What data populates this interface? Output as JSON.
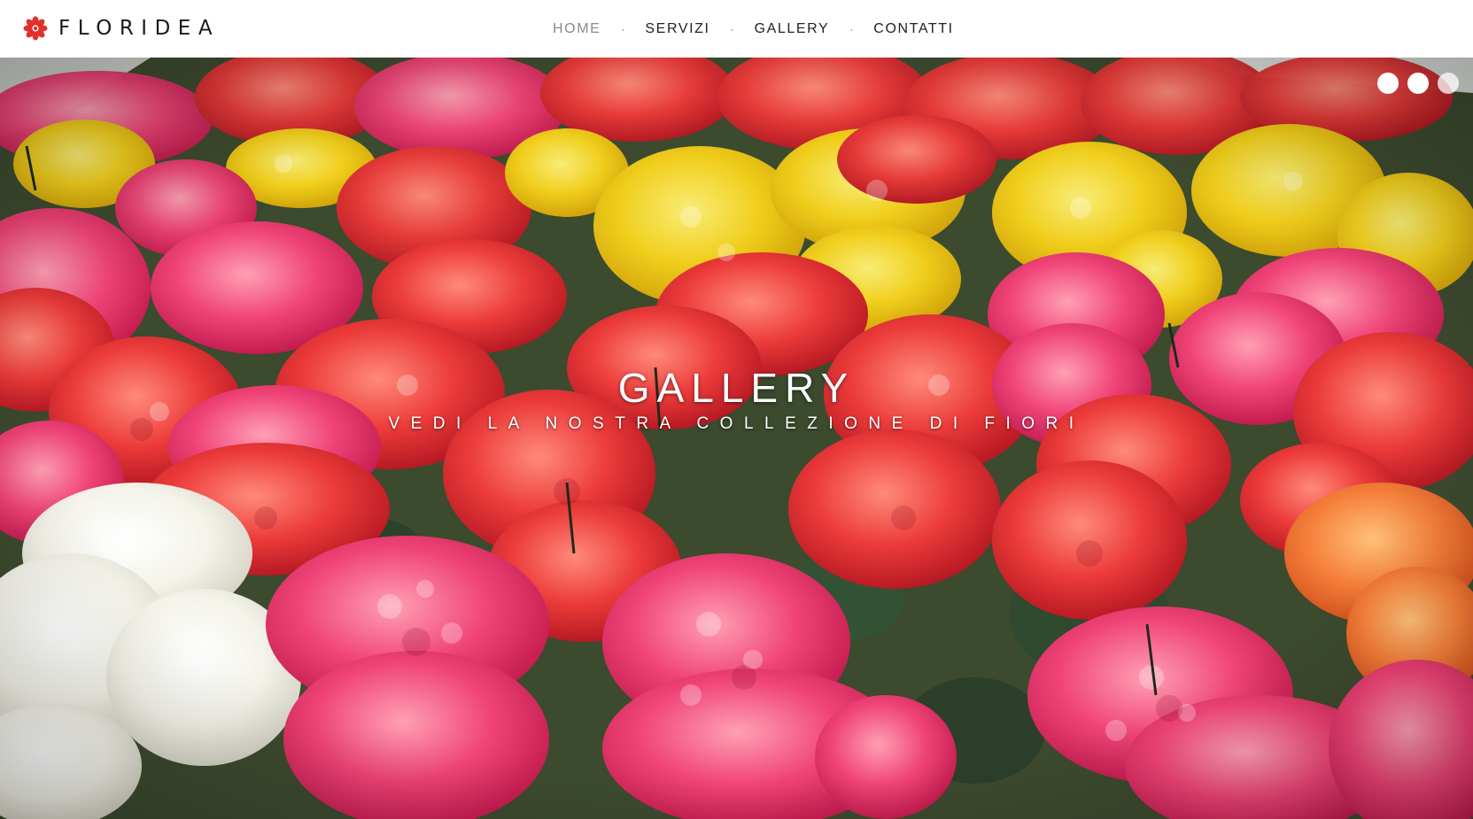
{
  "brand": {
    "name": "FLORIDEA",
    "icon": "flower-icon",
    "icon_color": "#e0312b"
  },
  "nav": {
    "items": [
      {
        "label": "HOME",
        "active": true
      },
      {
        "label": "SERVIZI",
        "active": false
      },
      {
        "label": "GALLERY",
        "active": false
      },
      {
        "label": "CONTATTI",
        "active": false
      }
    ],
    "separator": "·"
  },
  "hero": {
    "title": "GALLERY",
    "subtitle": "VEDI LA NOSTRA COLLEZIONE DI FIORI",
    "slider": {
      "slides": 3,
      "active_index": 0
    }
  },
  "colors": {
    "header_bg": "#ffffff",
    "nav_text": "#222222",
    "nav_active": "#8a8a8a",
    "accent": "#e0312b"
  }
}
